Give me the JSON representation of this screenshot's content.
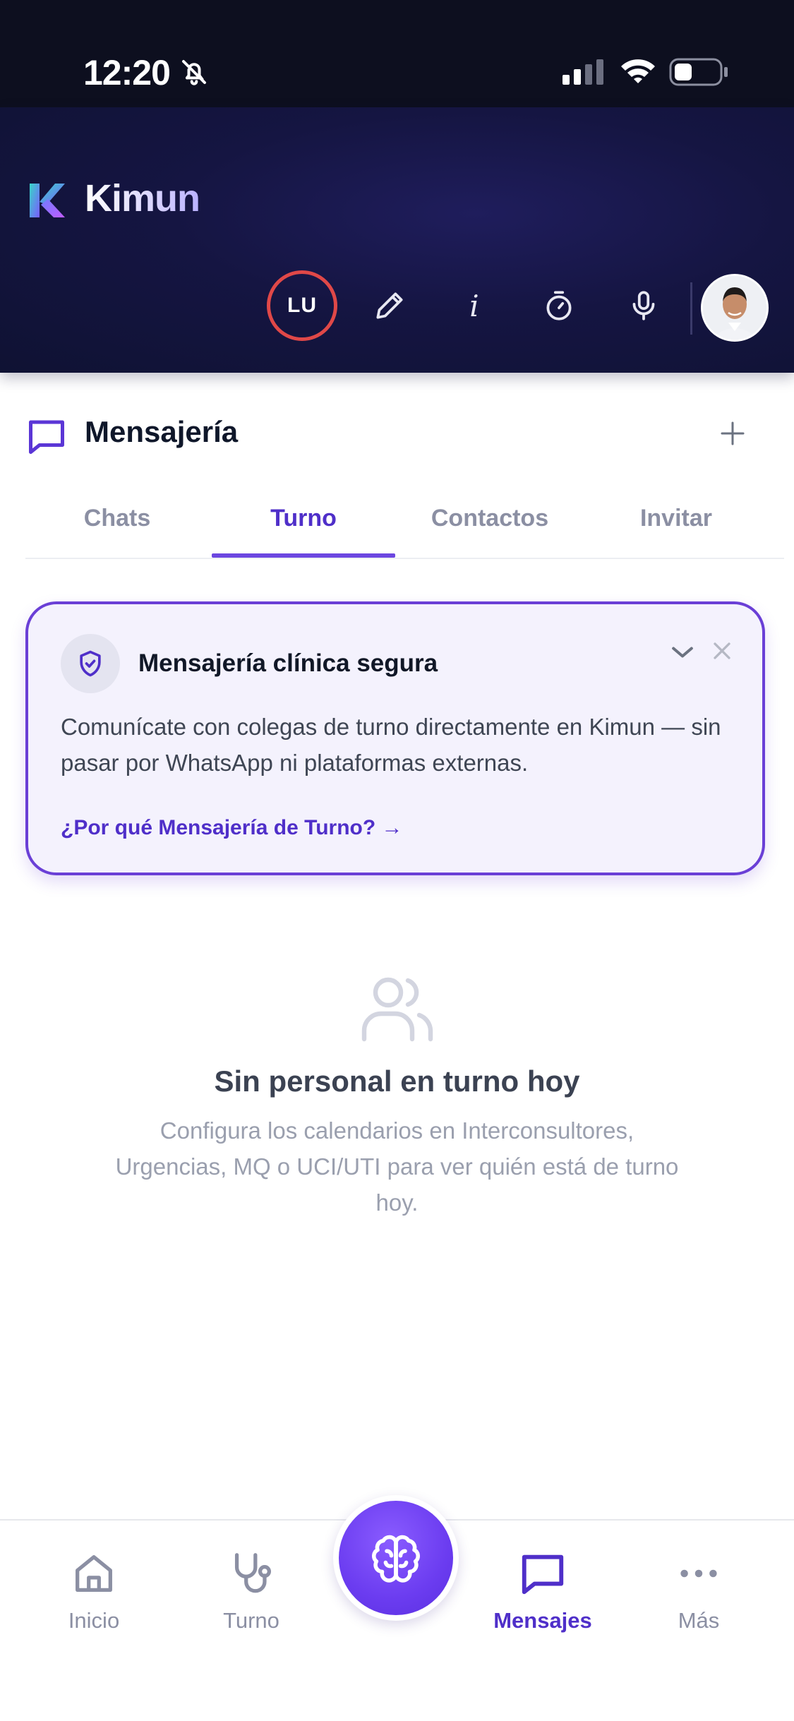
{
  "status_bar": {
    "time": "12:20"
  },
  "header": {
    "brand_name": "Kimun",
    "user_initials": "LU",
    "icons": [
      "pencil-icon",
      "info-icon",
      "timer-icon",
      "mic-icon"
    ]
  },
  "section": {
    "title": "Mensajería"
  },
  "tabs": [
    {
      "label": "Chats",
      "active": false
    },
    {
      "label": "Turno",
      "active": true
    },
    {
      "label": "Contactos",
      "active": false
    },
    {
      "label": "Invitar",
      "active": false
    }
  ],
  "info_card": {
    "title": "Mensajería clínica segura",
    "body": "Comunícate con colegas de turno directamente en Kimun — sin pasar por WhatsApp ni plataformas externas.",
    "link": "¿Por qué Mensajería de Turno? →"
  },
  "empty_state": {
    "title": "Sin personal en turno hoy",
    "description": "Configura los calendarios en Interconsultores, Urgencias, MQ o UCI/UTI para ver quién está de turno hoy."
  },
  "bottom_nav": {
    "items": [
      {
        "label": "Inicio",
        "icon": "home-icon"
      },
      {
        "label": "Turno",
        "icon": "stethoscope-icon"
      },
      {
        "label": "Mensajes",
        "icon": "message-icon",
        "active": true
      },
      {
        "label": "Más",
        "icon": "more-icon"
      }
    ],
    "center_button_icon": "brain-icon"
  },
  "colors": {
    "accent": "#6c47e0",
    "header_bg": "#151542",
    "alert_ring": "#e04848"
  }
}
